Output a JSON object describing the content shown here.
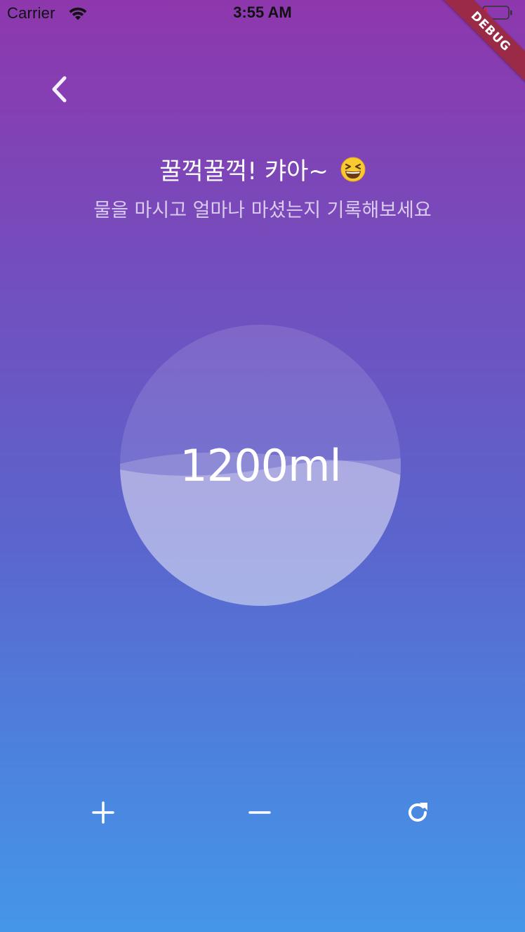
{
  "status_bar": {
    "carrier": "Carrier",
    "time": "3:55 AM",
    "wifi_icon": "wifi-icon",
    "battery_icon": "battery-icon"
  },
  "debug_banner": {
    "label": "DEBUG",
    "color": "#9a2a46"
  },
  "header": {
    "back_icon": "chevron-left-icon",
    "title": "꿀꺽꿀꺽! 캬아~",
    "title_emoji": "grinning-squinting-face-icon",
    "subtitle": "물을 마시고 얼마나 마셨는지 기록해보세요"
  },
  "water": {
    "amount_label": "1200ml",
    "fill_level": 0.52
  },
  "controls": {
    "plus_icon": "plus-icon",
    "minus_icon": "minus-icon",
    "reset_icon": "refresh-icon"
  },
  "colors": {
    "gradient_top": "#8e37ad",
    "gradient_bottom": "#4596e8",
    "text": "#ffffff"
  }
}
